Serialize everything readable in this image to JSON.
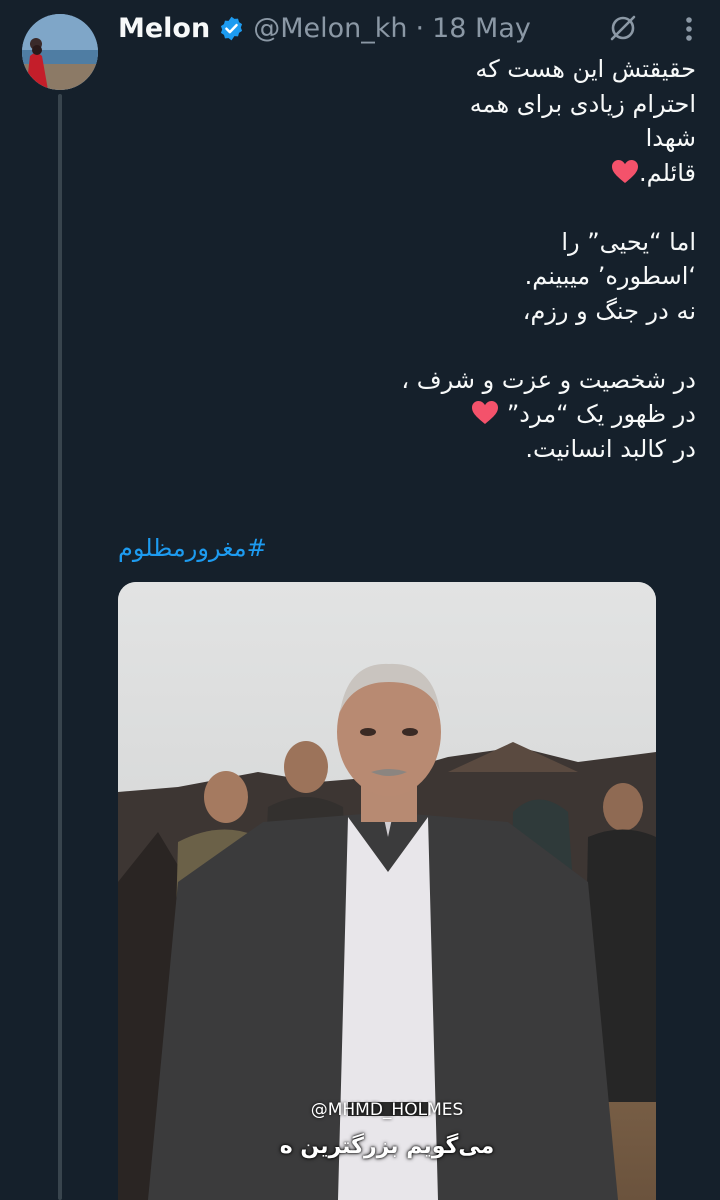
{
  "tweet": {
    "display_name": "Melon",
    "handle": "@Melon_kh",
    "separator": "·",
    "timestamp": "18 May",
    "lines": [
      "حقیقتش این هست که",
      "احترام زیادی برای همه",
      "شهدا",
      "قائلم.",
      "",
      "اما “یحیی” را",
      "‘اسطوره’ میبینم.",
      "نه در جنگ و رزم،",
      "",
      "در شخصیت و عزت و شرف ،",
      "در ظهور یک “مرد”",
      "در کالبد انسانیت."
    ],
    "hashtag": "#مغرورمظلوم",
    "media": {
      "watermark": "@MHMD_HOLMES",
      "subtitle": "می‌گویم بزرگترین ه"
    }
  },
  "colors": {
    "background": "#15202b",
    "link": "#1d9bf0",
    "muted": "#8b98a5",
    "verified": "#1d9bf0",
    "heart": "#f4526b"
  },
  "icons": [
    "verified-badge-icon",
    "grok-icon",
    "more-icon",
    "heart-emoji-icon"
  ]
}
